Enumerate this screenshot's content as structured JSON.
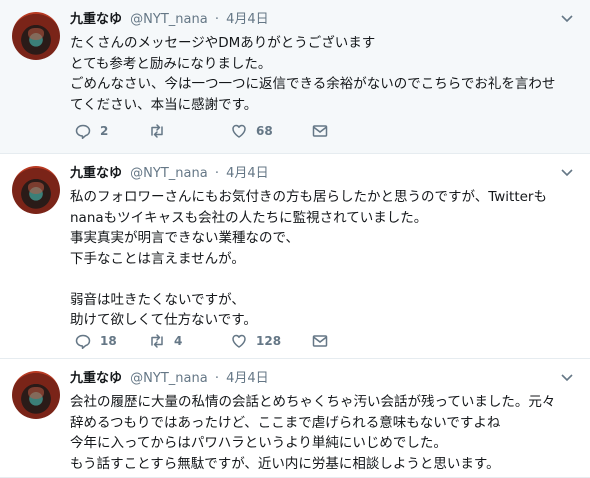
{
  "tweets": [
    {
      "name": "九重なゆ",
      "handle": "@NYT_nana",
      "dot": "·",
      "time": "4月4日",
      "lines": [
        "たくさんのメッセージやDMありがとうございます",
        "とても参考と励みになりました。",
        "ごめんなさい、今は一つ一つに返信できる余裕がないのでこちらでお礼を言わせ",
        "てください、本当に感謝です。"
      ],
      "reply_count": "2",
      "retweet_count": "",
      "like_count": "68"
    },
    {
      "name": "九重なゆ",
      "handle": "@NYT_nana",
      "dot": "·",
      "time": "4月4日",
      "lines": [
        "私のフォロワーさんにもお気付きの方も居らしたかと思うのですが、Twitterも",
        "nanaもツイキャスも会社の人たちに監視されていました。",
        "事実真実が明言できない業種なので、",
        "下手なことは言えませんが。",
        "",
        "弱音は吐きたくないですが、",
        "助けて欲しくて仕方ないです。"
      ],
      "reply_count": "18",
      "retweet_count": "4",
      "like_count": "128"
    },
    {
      "name": "九重なゆ",
      "handle": "@NYT_nana",
      "dot": "·",
      "time": "4月4日",
      "lines": [
        "会社の履歴に大量の私情の会話とめちゃくちゃ汚い会話が残っていました。元々",
        "辞めるつもりではあったけど、ここまで虐げられる意味もないですよね",
        "今年に入ってからはパワハラというより単純にいじめでした。",
        "もう話すことすら無駄ですが、近い内に労基に相談しようと思います。"
      ]
    }
  ],
  "icons": {
    "reply": "reply-icon",
    "retweet": "retweet-icon",
    "like": "heart-icon",
    "dm": "envelope-icon",
    "caret": "chevron-down-icon"
  },
  "colors": {
    "icon_gray": "#657786",
    "highlight_bg": "#f5f8fa",
    "divider": "#e6ecf0"
  }
}
